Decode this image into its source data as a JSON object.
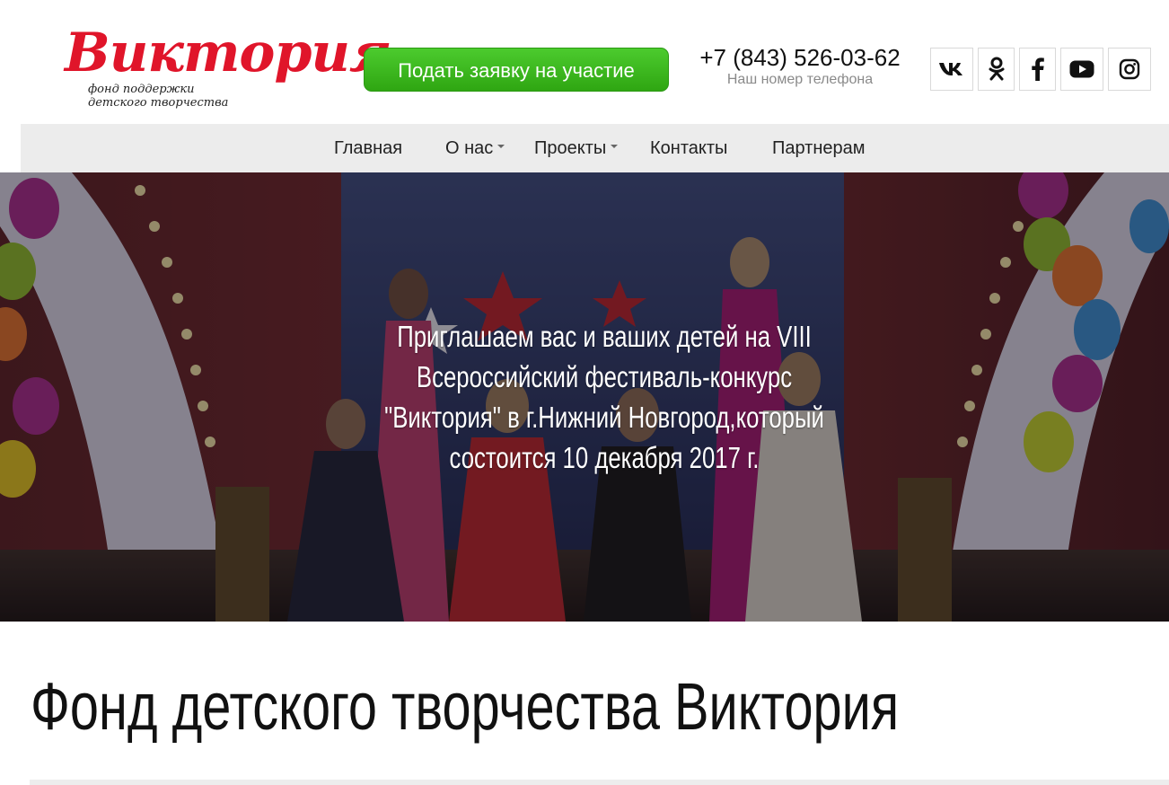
{
  "header": {
    "logo": {
      "name": "Виктория",
      "tagline_line1": "фонд поддержки",
      "tagline_line2": "детского творчества"
    },
    "cta_label": "Подать заявку на участие",
    "phone": {
      "number": "+7 (843) 526-03-62",
      "caption": "Наш номер телефона"
    },
    "socials": [
      {
        "icon": "vk-icon"
      },
      {
        "icon": "odnoklassniki-icon"
      },
      {
        "icon": "facebook-icon"
      },
      {
        "icon": "youtube-icon"
      },
      {
        "icon": "instagram-icon"
      }
    ]
  },
  "nav": {
    "items": [
      {
        "label": "Главная",
        "has_dropdown": false
      },
      {
        "label": "О нас",
        "has_dropdown": true
      },
      {
        "label": "Проекты",
        "has_dropdown": true
      },
      {
        "label": "Контакты",
        "has_dropdown": false
      },
      {
        "label": "Партнерам",
        "has_dropdown": false
      }
    ]
  },
  "hero": {
    "text": "Приглашаем вас и ваших детей на VIII Всероссийский фестиваль-конкурс \"Виктория\" в г.Нижний Новгород,который состоится 10 декабря 2017 г."
  },
  "main": {
    "title": "Фонд детского творчества Виктория"
  },
  "colors": {
    "brand_red": "#e0152a",
    "cta_green": "#3cb71e",
    "nav_bg": "#ececec"
  }
}
